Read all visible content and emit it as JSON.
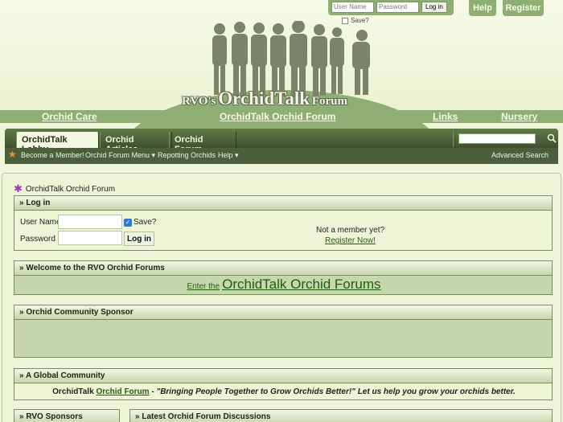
{
  "top_login": {
    "username_placeholder": "User Name",
    "password_placeholder": "Password",
    "login_label": "Log in",
    "save_label": "Save?"
  },
  "top_buttons": {
    "help": "Help",
    "register": "Register"
  },
  "logo": {
    "prefix": "RVO's",
    "name": "OrchidTalk",
    "suffix": "Forum"
  },
  "header_links": {
    "orchid_care": "Orchid Care",
    "forum": "OrchidTalk Orchid Forum",
    "links": "Links",
    "nursery": "Nursery"
  },
  "navbar": {
    "tabs": [
      "OrchidTalk Lobby",
      "Orchid Articles",
      "Orchid Forum"
    ],
    "sub_items": {
      "become_member": "Become a Member!",
      "forum_menu": "Orchid Forum Menu",
      "repotting": "Repotting Orchids",
      "help": "Help",
      "advanced_search": "Advanced Search"
    }
  },
  "breadcrumb": "OrchidTalk Orchid Forum",
  "login_block": {
    "title": "» Log in",
    "username_label": "User Name",
    "password_label": "Password",
    "save_label": "Save?",
    "login_button": "Log in",
    "not_member": "Not a member yet?",
    "register_now": "Register Now!"
  },
  "welcome_block": {
    "title": "» Welcome to the RVO Orchid Forums",
    "enter_small": "Enter the",
    "enter_big": "OrchidTalk Orchid Forums"
  },
  "sponsor_block": {
    "title": "» Orchid Community Sponsor"
  },
  "global_block": {
    "title": "» A Global Community",
    "lead": "OrchidTalk",
    "link": "Orchid Forum",
    "dash": " - ",
    "quote": "\"Bringing People Together to Grow Orchids Better!\"",
    "rest": " Let us help you grow your orchids better."
  },
  "bottom_blocks": {
    "sponsors": "» RVO Sponsors",
    "discussions": "» Latest Orchid Forum Discussions"
  },
  "colors": {
    "accent": "#8fae73",
    "nav_dark": "#3f5030",
    "block_body": "#c8d6ad",
    "link": "#1e5e10"
  },
  "icons": {
    "search": "search-icon",
    "star": "star-icon",
    "flower": "orchid-flower-icon"
  }
}
